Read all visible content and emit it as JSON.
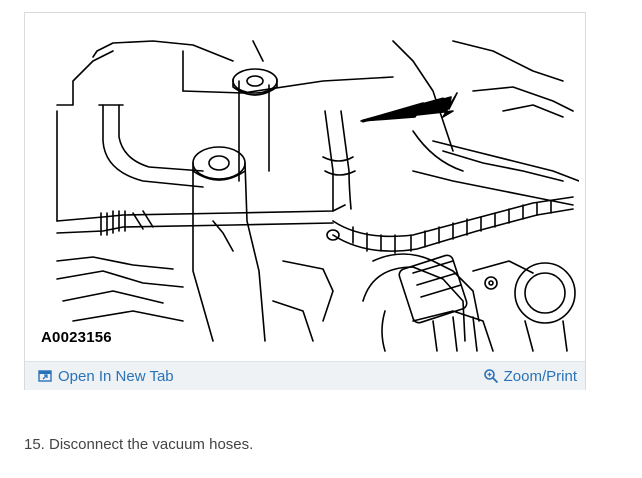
{
  "figure": {
    "id_label": "A0023156",
    "illustration": "engine-vacuum-hoses-diagram"
  },
  "toolbar": {
    "open_new_tab_label": "Open In New Tab",
    "open_new_tab_icon": "open-new-tab-icon",
    "zoom_print_label": "Zoom/Print",
    "zoom_print_icon": "zoom-icon",
    "link_color": "#2a72b7"
  },
  "step": {
    "text": "15. Disconnect the vacuum hoses."
  }
}
